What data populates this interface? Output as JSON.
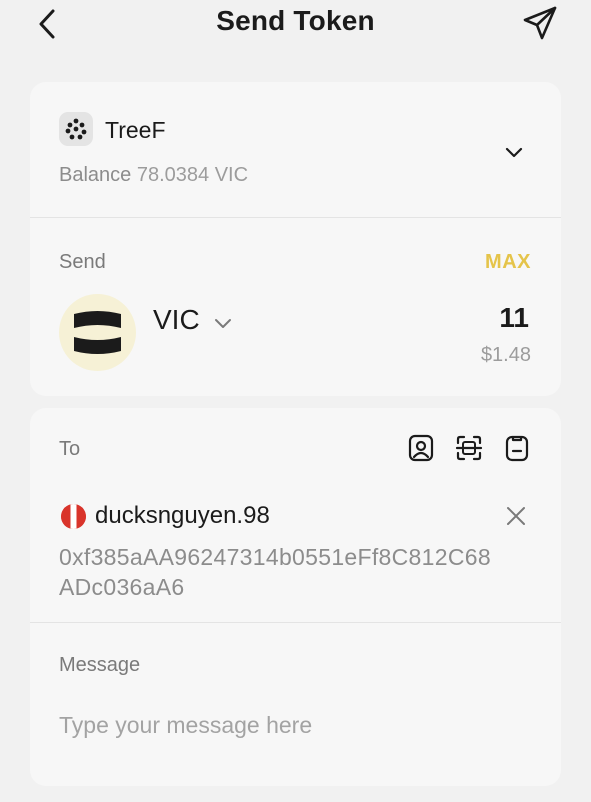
{
  "header": {
    "title": "Send Token",
    "back_icon": "chevron-left-icon",
    "send_icon": "paper-plane-icon"
  },
  "wallet": {
    "name": "TreeF",
    "balance_label": "Balance",
    "balance_value": "78.0384 VIC",
    "logo_icon": "dots-cluster-icon",
    "chevron_icon": "chevron-down-icon"
  },
  "send": {
    "label": "Send",
    "max_label": "MAX",
    "token_symbol": "VIC",
    "token_logo_icon": "viction-logo-icon",
    "amount": "11",
    "amount_usd": "$1.48"
  },
  "to": {
    "label": "To",
    "contact_icon": "address-book-icon",
    "scan_icon": "qr-scan-icon",
    "paste_icon": "clipboard-icon",
    "recipient_name": "ducksnguyen.98",
    "recipient_address": "0xf385aAA96247314b0551eFf8C812C68ADc036aA6",
    "clear_icon": "close-icon"
  },
  "message": {
    "label": "Message",
    "placeholder": "Type your message here",
    "value": ""
  },
  "colors": {
    "background": "#f1f1f1",
    "card": "#f7f7f7",
    "accent": "#e5c44a",
    "secondary_text": "#8c8c8c"
  }
}
